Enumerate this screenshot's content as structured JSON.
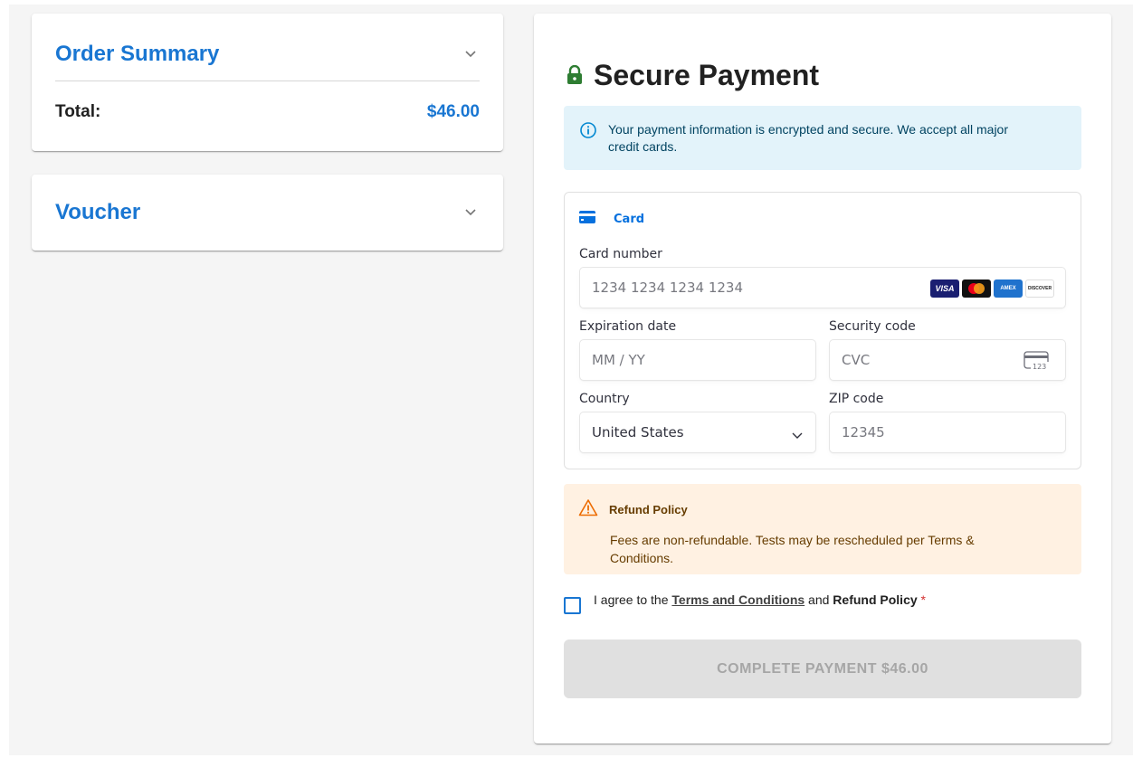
{
  "order_summary": {
    "title": "Order Summary",
    "total_label": "Total:",
    "total_value": "$46.00"
  },
  "voucher": {
    "title": "Voucher"
  },
  "payment": {
    "title": "Secure Payment",
    "info_text": "Your payment information is encrypted and secure. We accept all major credit cards.",
    "method_tab": "Card",
    "card_number_label": "Card number",
    "card_number_placeholder": "1234 1234 1234 1234",
    "brands": [
      "VISA",
      "AMEX",
      "DISCOVER"
    ],
    "expiry_label": "Expiration date",
    "expiry_placeholder": "MM / YY",
    "cvc_label": "Security code",
    "cvc_placeholder": "CVC",
    "cvc_icon_text": "123",
    "country_label": "Country",
    "country_value": "United States",
    "zip_label": "ZIP code",
    "zip_value": "12345",
    "refund_title": "Refund Policy",
    "refund_text": "Fees are non-refundable. Tests may be rescheduled per Terms & Conditions.",
    "agree_prefix": "I agree to the ",
    "agree_terms": "Terms and Conditions",
    "agree_and": " and ",
    "agree_refund": "Refund Policy",
    "agree_required": " *",
    "submit_label": "COMPLETE PAYMENT $46.00"
  },
  "colors": {
    "primary": "#1976d2",
    "info_bg": "#e3f3fa",
    "warning_bg": "#fff1e2",
    "lock_green": "#2e7d32",
    "disabled_button": "#e0e0e0"
  },
  "icons": [
    "chevron-down-icon",
    "lock-icon",
    "info-icon",
    "card-icon",
    "cvc-card-icon",
    "warning-icon"
  ]
}
